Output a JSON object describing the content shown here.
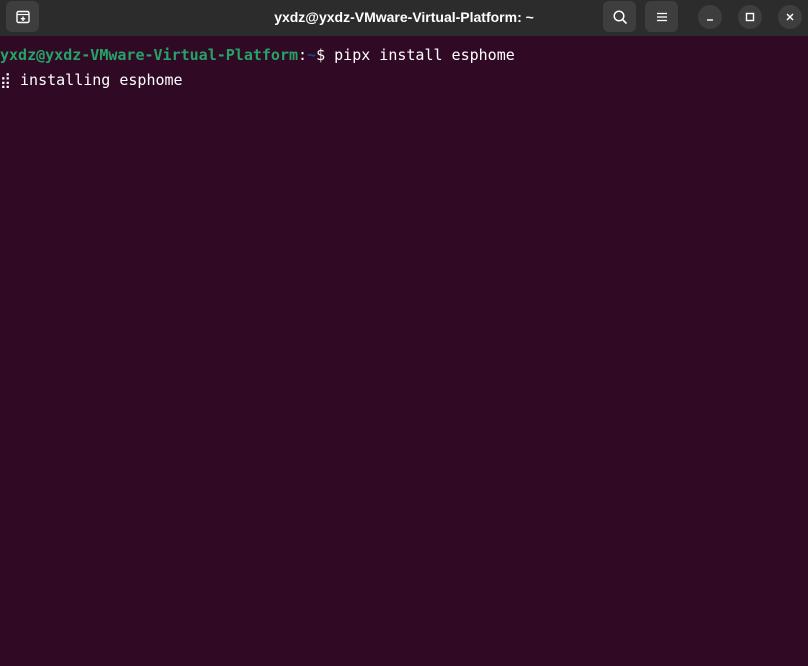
{
  "window": {
    "title": "yxdz@yxdz-VMware-Virtual-Platform: ~"
  },
  "colors": {
    "background": "#300a24",
    "titlebar": "#2c2c2c",
    "prompt_user": "#26a269",
    "prompt_path": "#12488b",
    "text": "#ffffff"
  },
  "icons": {
    "new_tab": "new-tab-icon",
    "search": "search-icon",
    "menu": "hamburger-menu-icon",
    "minimize": "minimize-icon",
    "maximize": "maximize-icon",
    "close": "close-icon"
  },
  "terminal": {
    "prompt_user": "yxdz@yxdz-VMware-Virtual-Platform",
    "prompt_sep": ":",
    "prompt_path": "~",
    "prompt_symbol": "$ ",
    "command": "pipx install esphome",
    "spinner": "⣾",
    "output_text": " installing esphome"
  }
}
